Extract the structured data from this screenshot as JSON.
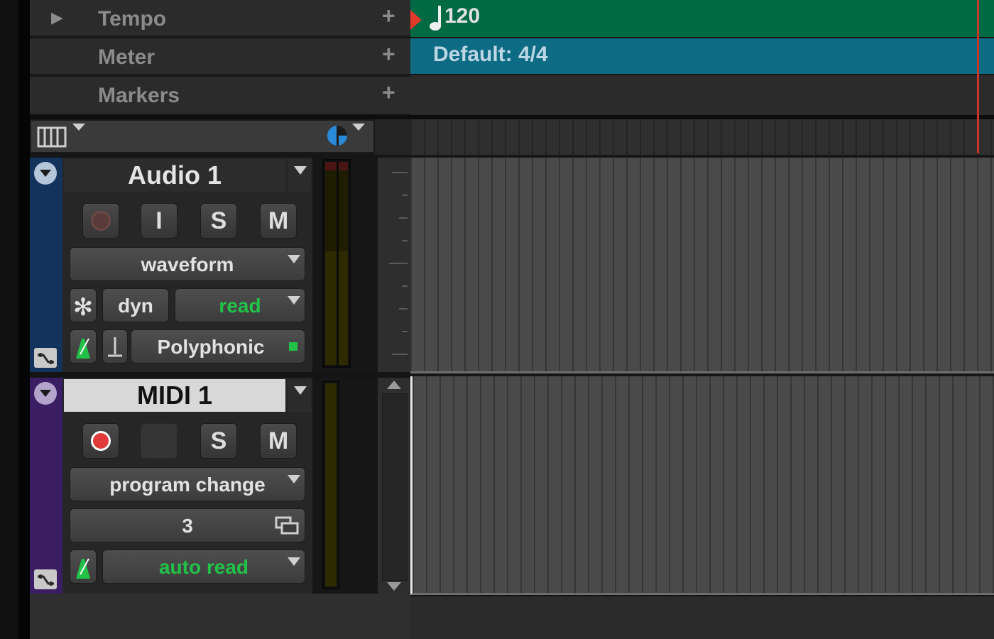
{
  "rulers": {
    "tempo": {
      "label": "Tempo",
      "add": "+",
      "value": "120"
    },
    "meter": {
      "label": "Meter",
      "add": "+",
      "value": "Default: 4/4"
    },
    "markers": {
      "label": "Markers",
      "add": "+"
    }
  },
  "tracks": {
    "audio": {
      "name": "Audio 1",
      "color": "#13325c",
      "buttons": {
        "input": "I",
        "solo": "S",
        "mute": "M"
      },
      "view": "waveform",
      "timebase_icon": "✻",
      "dyn": "dyn",
      "automation": "read",
      "elastic": "Polyphonic"
    },
    "midi": {
      "name": "MIDI 1",
      "color": "#3b1d63",
      "buttons": {
        "solo": "S",
        "mute": "M"
      },
      "view": "program change",
      "patch": "3",
      "automation": "auto read"
    }
  },
  "colors": {
    "tempo_lane": "#006a44",
    "meter_lane": "#0e6b84",
    "record_armed": "#e03a3a",
    "green_text": "#22c248",
    "playhead": "#c9352a"
  }
}
